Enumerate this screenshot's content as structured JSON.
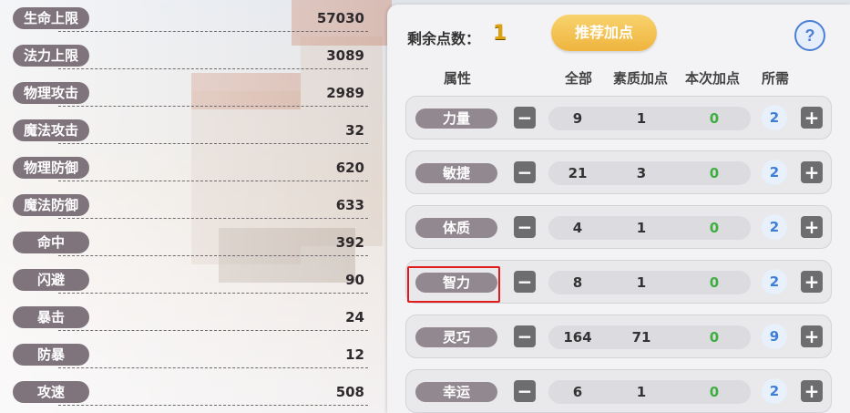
{
  "stats": [
    {
      "label": "生命上限",
      "value": "57030"
    },
    {
      "label": "法力上限",
      "value": "3089"
    },
    {
      "label": "物理攻击",
      "value": "2989"
    },
    {
      "label": "魔法攻击",
      "value": "32"
    },
    {
      "label": "物理防御",
      "value": "620"
    },
    {
      "label": "魔法防御",
      "value": "633"
    },
    {
      "label": "命中",
      "value": "392"
    },
    {
      "label": "闪避",
      "value": "90"
    },
    {
      "label": "暴击",
      "value": "24"
    },
    {
      "label": "防暴",
      "value": "12"
    },
    {
      "label": "攻速",
      "value": "508"
    }
  ],
  "panel": {
    "remaining_label": "剩余点数：",
    "remaining_value": "1",
    "recommend_label": "推荐加点",
    "help_label": "?",
    "headers": {
      "attr": "属性",
      "total": "全部",
      "base": "素质加点",
      "now": "本次加点",
      "need": "所需"
    }
  },
  "attributes": [
    {
      "name": "力量",
      "total": "9",
      "base": "1",
      "now": "0",
      "need": "2"
    },
    {
      "name": "敏捷",
      "total": "21",
      "base": "3",
      "now": "0",
      "need": "2"
    },
    {
      "name": "体质",
      "total": "4",
      "base": "1",
      "now": "0",
      "need": "2"
    },
    {
      "name": "智力",
      "total": "8",
      "base": "1",
      "now": "0",
      "need": "2"
    },
    {
      "name": "灵巧",
      "total": "164",
      "base": "71",
      "now": "0",
      "need": "9"
    },
    {
      "name": "幸运",
      "total": "6",
      "base": "1",
      "now": "0",
      "need": "2"
    }
  ],
  "controls": {
    "minus": "−",
    "plus": "+"
  },
  "colors": {
    "accent_button": "#efb43e",
    "remaining": "#e0a20c",
    "highlight": "#e21b1b",
    "now_value": "#3fae3f",
    "need_value": "#3e7ed6"
  }
}
